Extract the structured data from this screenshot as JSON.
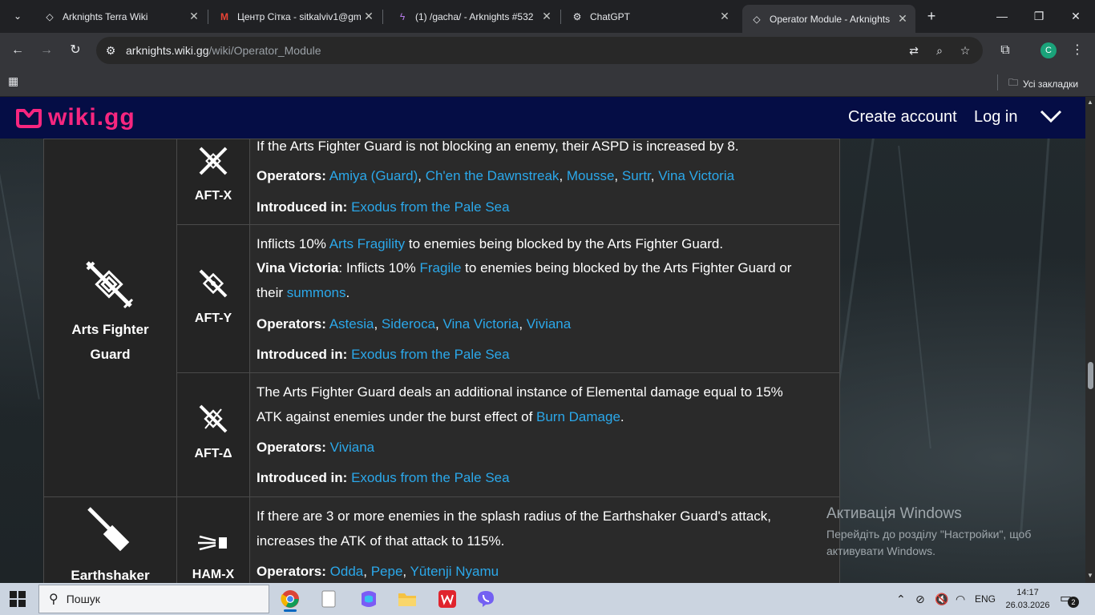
{
  "browser": {
    "tabs": [
      {
        "title": "Arknights Terra Wiki",
        "icon": "diamond-icon"
      },
      {
        "title": "Центр Сітка - sitkalviv1@gm",
        "icon": "gmail-icon"
      },
      {
        "title": "(1) /gacha/ - Arknights #532",
        "icon": "fourchan-icon"
      },
      {
        "title": "ChatGPT",
        "icon": "chatgpt-icon"
      },
      {
        "title": "Operator Module - Arknights",
        "icon": "diamond-icon",
        "active": true
      }
    ],
    "url_host": "arknights.wiki.gg",
    "url_path": "/wiki/Operator_Module",
    "profile_initial": "C",
    "bookmarks_label": "Усі закладки"
  },
  "site": {
    "logo_text": "wiki.gg",
    "create_account": "Create account",
    "login": "Log in",
    "brand_color": "#f7267f",
    "header_color": "#050d45",
    "link_color": "#2ba8ea"
  },
  "table": {
    "branches": [
      {
        "name_line1": "Arts Fighter",
        "name_line2": "Guard",
        "modules": [
          {
            "code": "AFT-X",
            "description": "If the Arts Fighter Guard is not blocking an enemy, their ASPD is increased by 8.",
            "operators_label": "Operators:",
            "operators": [
              "Amiya (Guard)",
              "Ch'en the Dawnstreak",
              "Mousse",
              "Surtr",
              "Vina Victoria"
            ],
            "introduced_label": "Introduced in:",
            "introduced": "Exodus from the Pale Sea"
          },
          {
            "code": "AFT-Y",
            "desc_parts": [
              "Inflicts 10% ",
              "Arts Fragility",
              " to enemies being blocked by the Arts Fighter Guard."
            ],
            "desc2_bold": "Vina Victoria",
            "desc2_parts": [
              ": Inflicts 10% ",
              "Fragile",
              " to enemies being blocked by the Arts Fighter Guard or"
            ],
            "desc3_parts": [
              "their ",
              "summons",
              "."
            ],
            "operators_label": "Operators:",
            "operators": [
              "Astesia",
              "Sideroca",
              "Vina Victoria",
              "Viviana"
            ],
            "introduced_label": "Introduced in:",
            "introduced": "Exodus from the Pale Sea"
          },
          {
            "code": "AFT-Δ",
            "desc_line1": "The Arts Fighter Guard deals an additional instance of Elemental damage equal to 15%",
            "desc_parts": [
              "ATK against enemies under the burst effect of ",
              "Burn Damage",
              "."
            ],
            "operators_label": "Operators:",
            "operators": [
              "Viviana"
            ],
            "introduced_label": "Introduced in:",
            "introduced": "Exodus from the Pale Sea"
          }
        ]
      },
      {
        "name_line1": "Earthshaker",
        "modules": [
          {
            "code": "HAM-X",
            "desc_line1": "If there are 3 or more enemies in the splash radius of the Earthshaker Guard's attack,",
            "desc_line2": "increases the ATK of that attack to 115%.",
            "operators_label": "Operators:",
            "operators": [
              "Odda",
              "Pepe",
              "Yūtenji Nyamu"
            ]
          }
        ]
      }
    ]
  },
  "watermark": {
    "title": "Активація Windows",
    "line1": "Перейдіть до розділу \"Настройки\", щоб",
    "line2": "активувати Windows."
  },
  "taskbar": {
    "search_label": "Пошук",
    "lang": "ENG",
    "time": "14:17",
    "date": "26.03.2026",
    "notifications": "2"
  }
}
